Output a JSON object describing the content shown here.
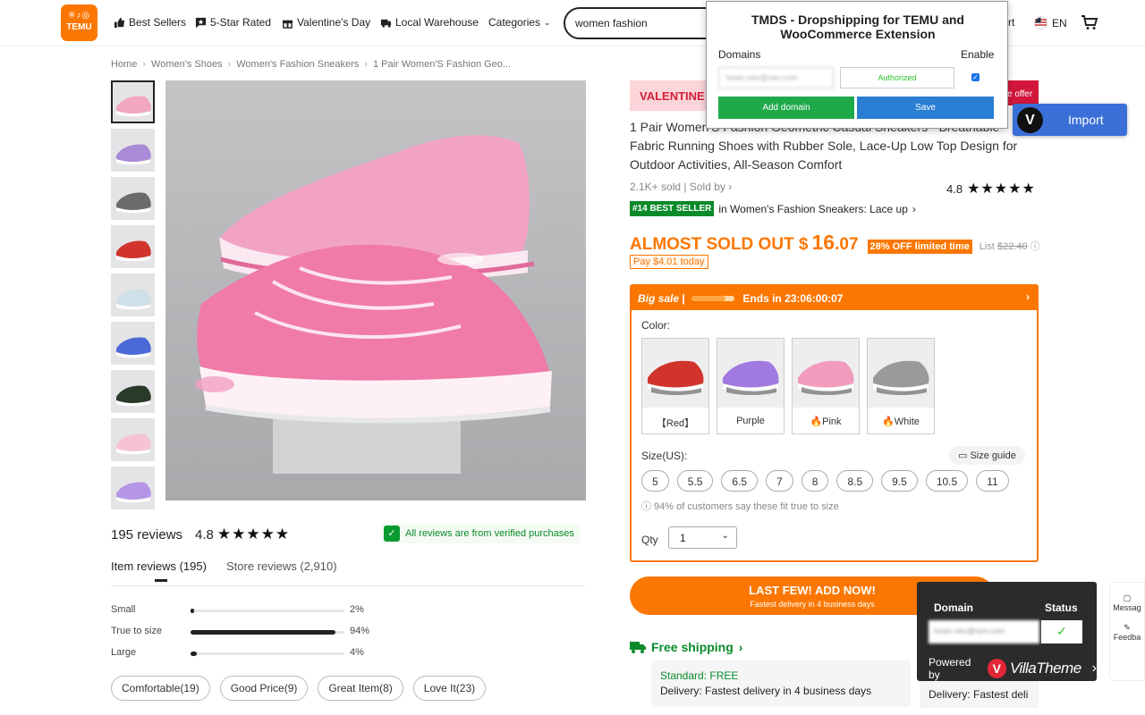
{
  "header": {
    "logo_top": "※♪◎",
    "logo_text": "TEMU",
    "nav": [
      "Best Sellers",
      "5-Star Rated",
      "Valentine's Day",
      "Local Warehouse",
      "Categories"
    ],
    "search_value": "women fashion",
    "account_partial": "rt",
    "lang": "EN"
  },
  "breadcrumb": [
    "Home",
    "Women's Shoes",
    "Women's Fashion Sneakers",
    "1 Pair Women'S Fashion Geo..."
  ],
  "gallery": {
    "thumb_colors": [
      "#f3a6c2",
      "#a98ad6",
      "#6b6b6b",
      "#d0342c",
      "#cfe0e8",
      "#4a6ad8",
      "#2a3a2a",
      "#f7c3d4",
      "#b596e6"
    ]
  },
  "reviews": {
    "count_label": "195 reviews",
    "rating": "4.8",
    "stars": "★★★★★",
    "verified": "All reviews are from verified purchases",
    "tab_item": "Item reviews (195)",
    "tab_store": "Store reviews (2,910)",
    "fit": [
      {
        "label": "Small",
        "pct": "2%",
        "value": 0.02
      },
      {
        "label": "True to size",
        "pct": "94%",
        "value": 0.94
      },
      {
        "label": "Large",
        "pct": "4%",
        "value": 0.04
      }
    ],
    "chips": [
      "Comfortable(19)",
      "Good Price(9)",
      "Great Item(8)",
      "Love It(23)"
    ]
  },
  "product": {
    "valentine_badge": "VALENTINE",
    "offer_badge": "e offer",
    "title": "1 Pair Women'S Fashion Geometric Casual Sneakers - Breathable Fabric Running Shoes with Rubber Sole, Lace-Up Low Top Design for Outdoor Activities, All-Season Comfort",
    "sold": "2.1K+ sold",
    "sold_by": "Sold by",
    "rating": "4.8",
    "stars": "★★★★★",
    "best_seller_badge": "#14 BEST SELLER",
    "best_seller_text": "in Women's Fashion Sneakers: Lace up",
    "price_prefix": "ALMOST SOLD OUT $",
    "price_int": "16",
    "price_dec": ".07",
    "discount": "28% OFF limited time",
    "list_label": "List",
    "list_price": "$22.40",
    "pay_today": "Pay $4.01 today",
    "big_sale": "Big sale",
    "ends": "Ends in 23:06:00:07",
    "sale_progress": 0.8,
    "color_label": "Color:",
    "colors": [
      {
        "label": "【Red】",
        "color": "#d0342c"
      },
      {
        "label": "Purple",
        "color": "#a07ae0"
      },
      {
        "label": "Pink",
        "color": "#f29bbd"
      },
      {
        "label": "White",
        "color": "#9a9a9a"
      }
    ],
    "size_label": "Size(US):",
    "size_guide": "Size guide",
    "sizes": [
      "5",
      "5.5",
      "6.5",
      "7",
      "8",
      "8.5",
      "9.5",
      "10.5",
      "11"
    ],
    "fit_note": "ⓘ 94% of customers say these fit true to size",
    "qty_label": "Qty",
    "qty_value": "1",
    "add_btn": "LAST FEW! ADD NOW!",
    "add_sub": "Fastest delivery in 4 business days",
    "free_shipping": "Free shipping",
    "standard": "Standard: FREE",
    "delivery": "Delivery: Fastest delivery in 4 business days",
    "express_partial": "Delivery: Fastest deli"
  },
  "tmds": {
    "title": "TMDS - Dropshipping for TEMU and WooCommerce Extension",
    "domains_label": "Domains",
    "enable_label": "Enable",
    "domain_value": "hoan.nev@nev.com",
    "authorized": "Authorized",
    "add_domain": "Add domain",
    "save": "Save"
  },
  "import_btn": "Import",
  "villatheme": {
    "domain_label": "Domain",
    "status_label": "Status",
    "domain_value": "hoan.nev@nev.com",
    "status_value": "✓",
    "powered_by": "Powered by",
    "brand": "VillaTheme"
  },
  "side_tools": [
    "Messag",
    "Feedba"
  ]
}
